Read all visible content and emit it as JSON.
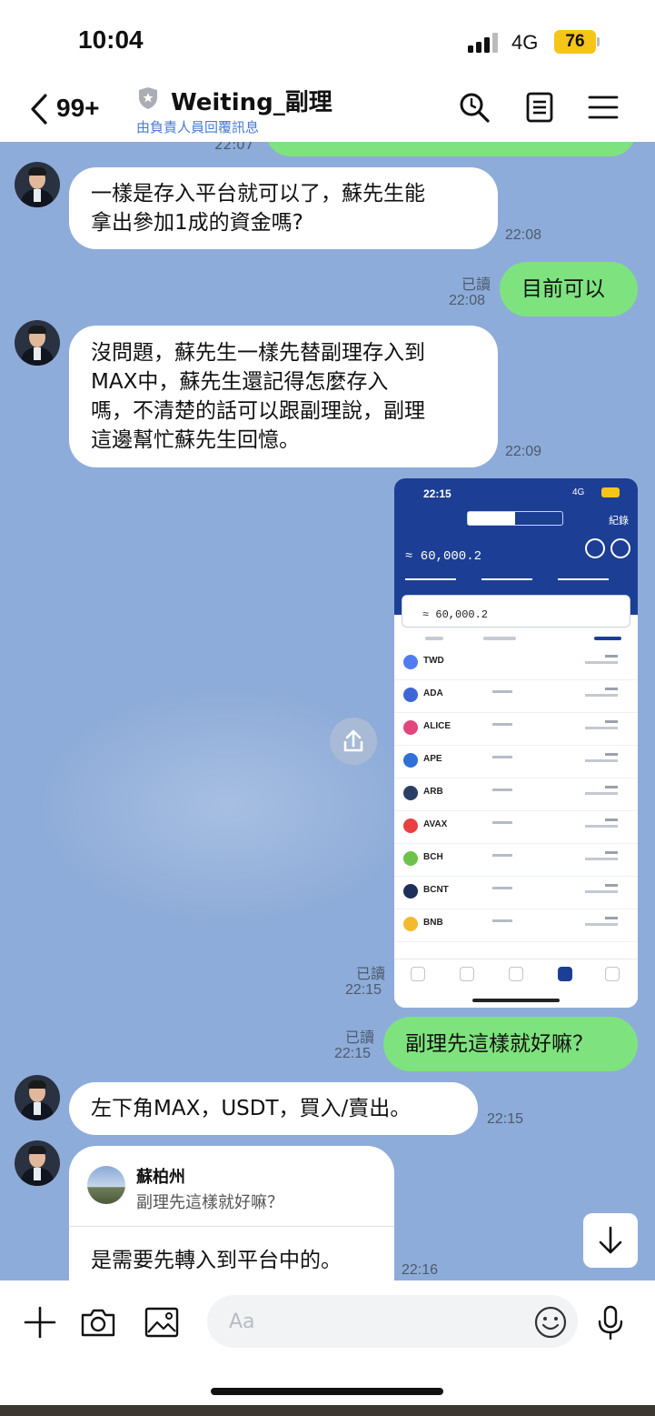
{
  "status_bar": {
    "time": "10:04",
    "network": "4G",
    "battery": "76"
  },
  "header": {
    "back_count": "99+",
    "title": "Weiting_副理",
    "subtitle": "由負責人員回覆訊息"
  },
  "messages": [
    {
      "id": "prev",
      "time": "22:07"
    },
    {
      "id": "m1",
      "side": "in",
      "text": "一樣是存入平台就可以了，蘇先生能\n拿出參加1成的資金嗎?",
      "time": "22:08"
    },
    {
      "id": "m2",
      "side": "out",
      "text": "目前可以",
      "read": "已讀",
      "time": "22:08"
    },
    {
      "id": "m3",
      "side": "in",
      "text": "沒問題，蘇先生一樣先替副理存入到\nMAX中，蘇先生還記得怎麼存入\n嗎，不清楚的話可以跟副理說，副理\n這邊幫忙蘇先生回憶。",
      "time": "22:09"
    },
    {
      "id": "m4",
      "side": "out",
      "type": "image",
      "read": "已讀",
      "time": "22:15"
    },
    {
      "id": "m5",
      "side": "out",
      "text": "副理先這樣就好嘛？",
      "read": "已讀",
      "time": "22:15"
    },
    {
      "id": "m6",
      "side": "in",
      "text": "左下角MAX，USDT，買入/賣出。",
      "time": "22:15"
    },
    {
      "id": "m7",
      "side": "in",
      "quote_name": "蘇柏州",
      "quote_text": "副理先這樣就好嘛？",
      "text": "是需要先轉入到平台中的。",
      "time": "22:16"
    }
  ],
  "screenshot": {
    "time": "22:15",
    "network": "4G",
    "record_label": "紀錄",
    "balance": "≈ 60,000.2",
    "balance_box": "≈ 60,000.2",
    "assets": [
      "TWD",
      "ADA",
      "ALICE",
      "APE",
      "ARB",
      "AVAX",
      "BCH",
      "BCNT",
      "BNB"
    ]
  },
  "input": {
    "placeholder": "Aa"
  },
  "icons": {
    "back": "chevron-left-icon",
    "search": "search-icon",
    "notes": "notes-icon",
    "menu": "hamburger-menu-icon",
    "share": "share-icon",
    "scroll_down": "arrow-down-icon",
    "plus": "plus-icon",
    "camera": "camera-icon",
    "image": "image-icon",
    "emoji": "emoji-icon",
    "mic": "microphone-icon"
  },
  "colors": {
    "chat_bg": "#8eacd9",
    "outgoing_bubble": "#7ee37e",
    "incoming_bubble": "#ffffff",
    "subtitle": "#4a7bd0"
  }
}
